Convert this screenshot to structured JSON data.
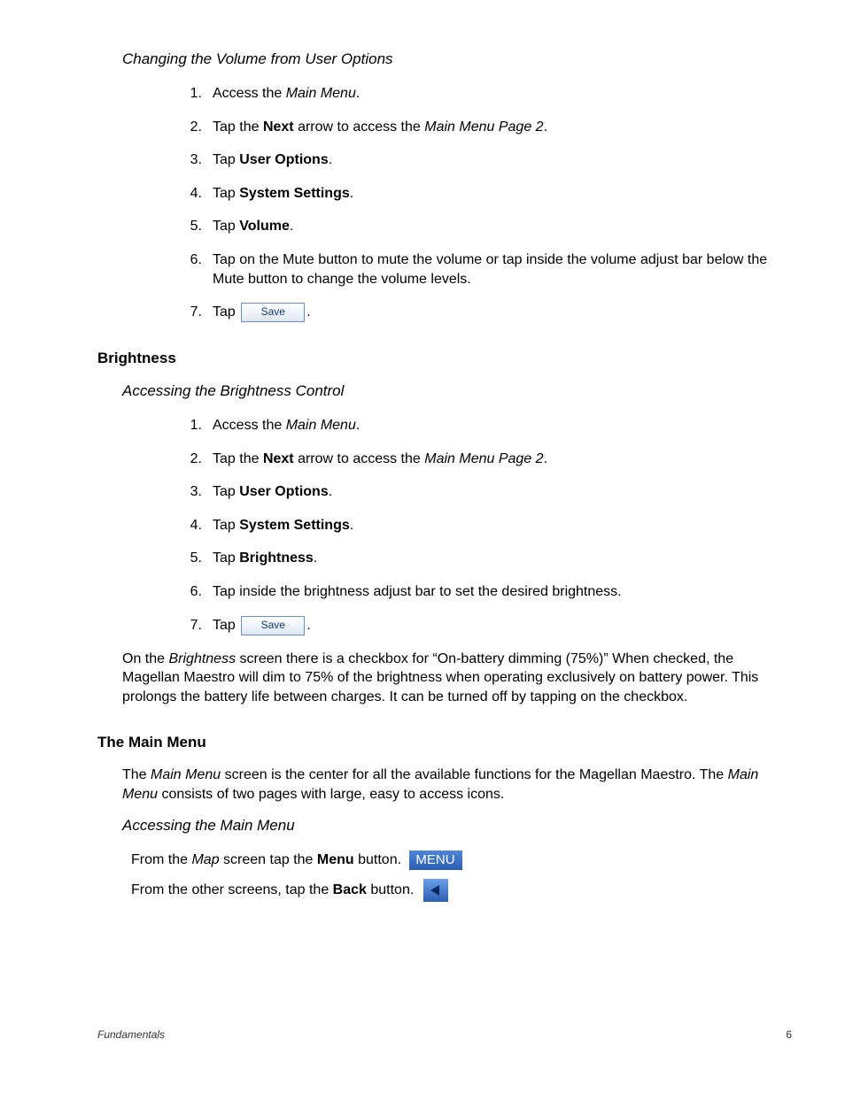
{
  "section1": {
    "title": "Changing the Volume from User Options",
    "steps": [
      {
        "n": "1.",
        "pre": "Access the ",
        "ital": "Main Menu",
        "post": "."
      },
      {
        "n": "2.",
        "pre": "Tap the ",
        "bold": "Next",
        "mid": " arrow to access the ",
        "ital": "Main Menu Page 2",
        "post": "."
      },
      {
        "n": "3.",
        "pre": "Tap ",
        "bold": "User Options",
        "post": "."
      },
      {
        "n": "4.",
        "pre": "Tap ",
        "bold": "System Settings",
        "post": "."
      },
      {
        "n": "5.",
        "pre": "Tap ",
        "bold": "Volume",
        "post": "."
      },
      {
        "n": "6.",
        "text": "Tap on the Mute button to mute the volume or tap inside the volume adjust bar below the Mute button to change the volume levels."
      },
      {
        "n": "7.",
        "pre": "Tap ",
        "savebtn": true,
        "post": "."
      }
    ]
  },
  "brightness": {
    "heading": "Brightness",
    "sub": "Accessing the Brightness Control",
    "steps": [
      {
        "n": "1.",
        "pre": "Access the ",
        "ital": "Main Menu",
        "post": "."
      },
      {
        "n": "2.",
        "pre": "Tap the ",
        "bold": "Next",
        "mid": " arrow to access the ",
        "ital": "Main Menu Page 2",
        "post": "."
      },
      {
        "n": "3.",
        "pre": "Tap ",
        "bold": "User Options",
        "post": "."
      },
      {
        "n": "4.",
        "pre": "Tap ",
        "bold": "System Settings",
        "post": "."
      },
      {
        "n": "5.",
        "pre": "Tap ",
        "bold": "Brightness",
        "post": "."
      },
      {
        "n": "6.",
        "text": "Tap inside the brightness adjust bar to set the desired brightness."
      },
      {
        "n": "7.",
        "pre": "Tap ",
        "savebtn": true,
        "post": "."
      }
    ],
    "note_pre": "On the ",
    "note_ital": "Brightness",
    "note_post": " screen there is a checkbox for “On-battery dimming (75%)”  When checked, the Magellan Maestro will dim to 75% of the brightness when operating exclusively on battery power. This prolongs the battery life between charges.  It can be turned off by tapping on the checkbox."
  },
  "mainmenu": {
    "heading": "The Main Menu",
    "intro_pre": "The ",
    "intro_ital1": "Main Menu",
    "intro_mid": " screen is the center for all the available functions for the Magellan Maestro.  The ",
    "intro_ital2": "Main Menu",
    "intro_post": " consists of two pages with large, easy to access icons.",
    "sub": "Accessing the Main Menu",
    "line1_pre": "From the ",
    "line1_ital": "Map",
    "line1_mid": " screen tap the ",
    "line1_bold": "Menu",
    "line1_post": " button.",
    "line2_pre": "From the other screens, tap the ",
    "line2_bold": "Back",
    "line2_post": " button."
  },
  "buttons": {
    "save": "Save",
    "menu": "MENU"
  },
  "footer": {
    "section": "Fundamentals",
    "page": "6"
  }
}
